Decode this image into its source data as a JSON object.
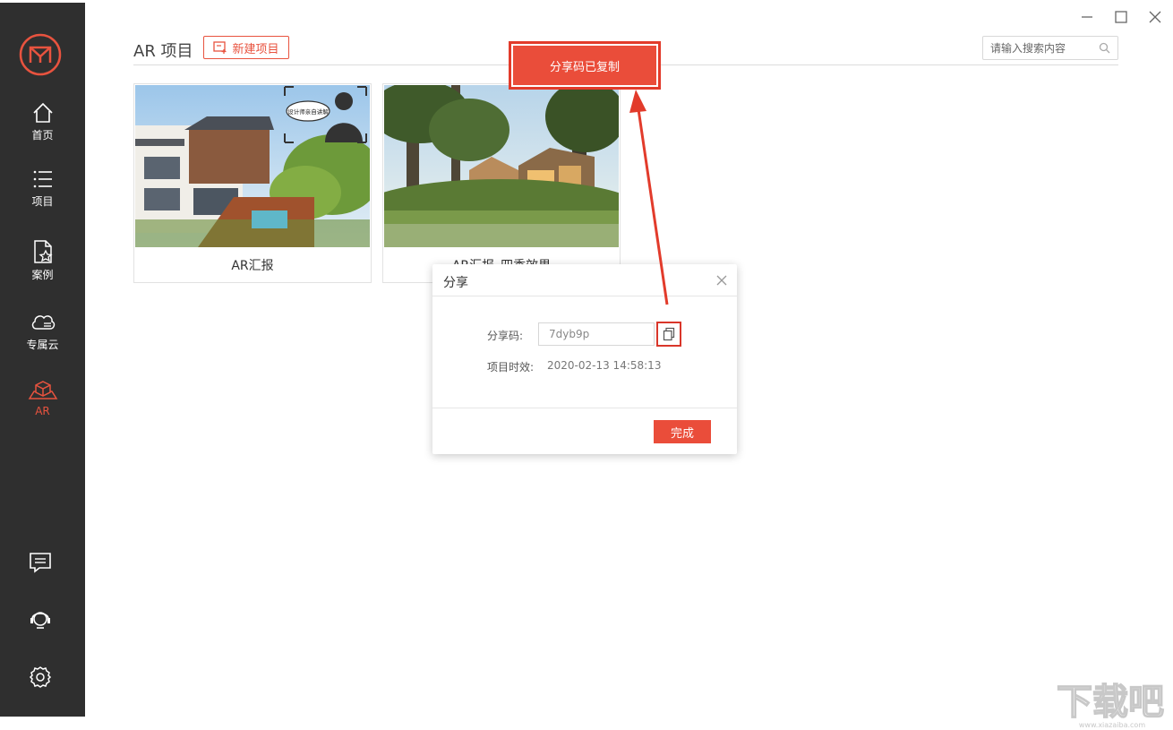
{
  "sidebar": {
    "items": [
      {
        "label": "首页",
        "icon": "home-icon"
      },
      {
        "label": "项目",
        "icon": "list-icon"
      },
      {
        "label": "案例",
        "icon": "document-star-icon"
      },
      {
        "label": "专属云",
        "icon": "cloud-icon"
      },
      {
        "label": "AR",
        "icon": "ar-box-icon",
        "active": true
      }
    ],
    "bottom_icons": [
      "message-icon",
      "headset-icon",
      "gear-icon"
    ]
  },
  "header": {
    "title": "AR 项目",
    "new_project_label": "新建项目",
    "search_placeholder": "请输入搜索内容"
  },
  "cards": [
    {
      "caption": "AR汇报",
      "badge": "设计师亲自讲解"
    },
    {
      "caption": "AR汇报_四季效果"
    }
  ],
  "toast": {
    "text": "分享码已复制"
  },
  "dialog": {
    "title": "分享",
    "share_code_label": "分享码:",
    "share_code_value": "7dyb9p",
    "validity_label": "项目时效:",
    "validity_value": "2020-02-13 14:58:13",
    "done_label": "完成"
  },
  "watermark": {
    "text": "下载吧",
    "site": "www.xiazaiba.com"
  },
  "colors": {
    "accent": "#ea4d3a",
    "sidebar": "#2f2f2f",
    "annotation": "#e23b2b"
  }
}
